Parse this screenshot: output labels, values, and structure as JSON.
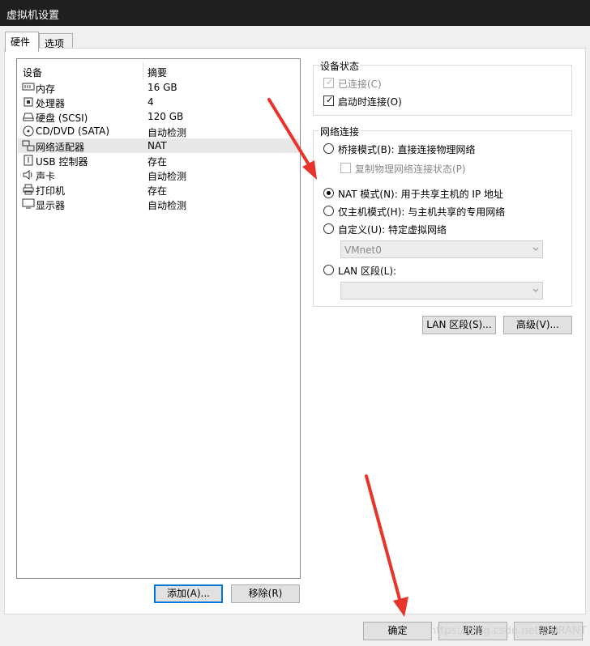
{
  "window": {
    "title": "虚拟机设置"
  },
  "tabs": [
    {
      "label": "硬件"
    },
    {
      "label": "选项"
    }
  ],
  "device_list": {
    "headers": {
      "device": "设备",
      "summary": "摘要"
    },
    "rows": [
      {
        "name": "内存",
        "summary": "16 GB",
        "icon": "memory-icon"
      },
      {
        "name": "处理器",
        "summary": "4",
        "icon": "processor-icon"
      },
      {
        "name": "硬盘 (SCSI)",
        "summary": "120 GB",
        "icon": "hard-disk-icon"
      },
      {
        "name": "CD/DVD (SATA)",
        "summary": "自动检测",
        "icon": "cd-dvd-icon"
      },
      {
        "name": "网络适配器",
        "summary": "NAT",
        "icon": "network-adapter-icon"
      },
      {
        "name": "USB 控制器",
        "summary": "存在",
        "icon": "usb-icon"
      },
      {
        "name": "声卡",
        "summary": "自动检测",
        "icon": "speaker-icon"
      },
      {
        "name": "打印机",
        "summary": "存在",
        "icon": "printer-icon"
      },
      {
        "name": "显示器",
        "summary": "自动检测",
        "icon": "monitor-icon"
      }
    ],
    "selected": "网络适配器"
  },
  "buttons": {
    "add": "添加(A)...",
    "remove": "移除(R)",
    "lan_segments": "LAN 区段(S)...",
    "advanced": "高级(V)...",
    "ok": "确定",
    "cancel": "取消",
    "help": "帮助"
  },
  "device_status": {
    "title": "设备状态",
    "connected": {
      "label": "已连接(C)",
      "checked": true,
      "enabled": false
    },
    "connect_at_power_on": {
      "label": "启动时连接(O)",
      "checked": true,
      "enabled": true
    }
  },
  "network_connection": {
    "title": "网络连接",
    "options": {
      "bridged": "桥接模式(B): 直接连接物理网络",
      "replicate": "复制物理网络连接状态(P)",
      "nat": "NAT 模式(N): 用于共享主机的 IP 地址",
      "host_only": "仅主机模式(H): 与主机共享的专用网络",
      "custom": "自定义(U): 特定虚拟网络",
      "lan_segment": "LAN 区段(L):"
    },
    "selected": "nat",
    "custom_network_value": "VMnet0",
    "lan_segment_value": ""
  },
  "watermark": "https://blog.csdn.net/DURANT",
  "colors": {
    "accent": "#0078d7",
    "annotation_arrow": "#e8342a",
    "titlebar": "#1f1f1f"
  }
}
